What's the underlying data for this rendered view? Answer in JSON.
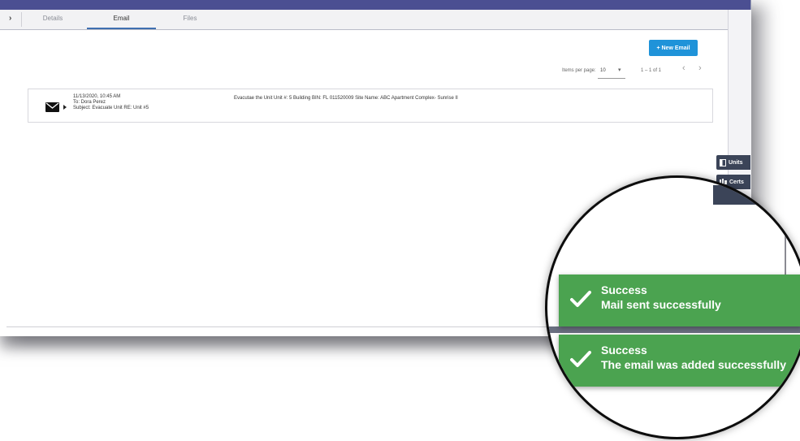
{
  "tabs": [
    {
      "label": "Details"
    },
    {
      "label": "Email"
    },
    {
      "label": "Files"
    }
  ],
  "toolbar": {
    "new_email_label": "+ New Email"
  },
  "pagination": {
    "items_per_page_label": "Items per page:",
    "items_per_page_value": "10",
    "range_label": "1 – 1 of 1"
  },
  "emails": [
    {
      "date": "11/13/2020, 10:45 AM",
      "to": "To: Dora Perez",
      "subject": "Subject: Evacuate Unit RE: Unit #5",
      "body": "Evacutae the Unit Unit #: 5 Building BIN: FL 011520009 Site Name: ABC Apartment Complex- Sunrise II"
    }
  ],
  "side_panel": {
    "units_label": "Units",
    "certs_label": "Certs"
  },
  "toasts": [
    {
      "title": "Success",
      "message": "Mail sent successfully"
    },
    {
      "title": "Success",
      "message": "The email was added successfully"
    }
  ],
  "colors": {
    "accent_blue": "#1f93d9",
    "header_navy": "#4b4f92",
    "side_pill": "#3b4458",
    "toast_green": "#4ba350"
  }
}
